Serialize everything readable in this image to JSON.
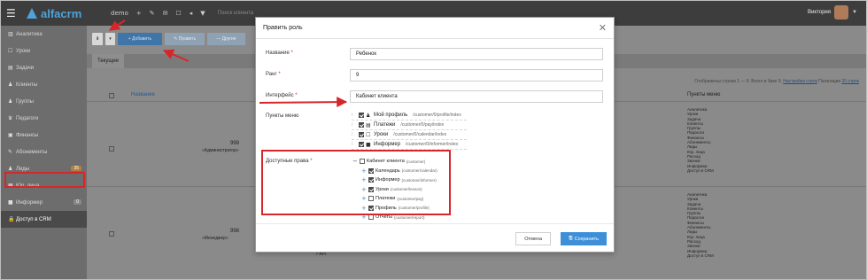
{
  "topbar": {
    "logo_text": "alfacrm",
    "menu_icon": "☰",
    "logo_mark": "logo-triangle",
    "icons": [
      "demo",
      "+",
      "✎",
      "✉",
      "☐",
      "◂",
      "▼"
    ],
    "icons_names": [
      "demo-menu-icon",
      "plus-icon",
      "pencil-icon",
      "mail-icon",
      "square-icon",
      "arrow-icon",
      "filter-icon"
    ],
    "search_placeholder": "Поиск клиента",
    "user_name": "Виктория",
    "user_caret": "▼"
  },
  "sidebar": {
    "items": [
      {
        "icon": "▥",
        "label": "Аналитика"
      },
      {
        "icon": "☐",
        "label": "Уроки"
      },
      {
        "icon": "▤",
        "label": "Задачи"
      },
      {
        "icon": "♟",
        "label": "Клиенты"
      },
      {
        "icon": "♟",
        "label": "Группы"
      },
      {
        "icon": "♛",
        "label": "Педагоги"
      },
      {
        "icon": "▣",
        "label": "Финансы"
      },
      {
        "icon": "✎",
        "label": "Абонементы"
      },
      {
        "icon": "♟",
        "label": "Лиды",
        "badge": "35"
      },
      {
        "icon": "▦",
        "label": "Юр. лица"
      },
      {
        "icon": "■",
        "label": "Информер",
        "badge": "0"
      },
      {
        "icon": "🔒",
        "label": "Доступ в CRM",
        "active": true
      }
    ]
  },
  "toolbar": {
    "sort_label": "⬇",
    "filter_label": "▾",
    "add_label": "+ Добавить",
    "edit_label": "✎ Править",
    "other_label": "— Другие"
  },
  "tabs": {
    "current": "Текущие"
  },
  "table": {
    "records_prefix": "Отображены строки 1 — 9. Всего в базе 9.",
    "settings_link": "Настройка строк",
    "pagination_label": "Пагинация",
    "pagination_value": "20 строк",
    "col_name": "Название",
    "col_menu": "Пункты меню",
    "rows": [
      {
        "num": "999",
        "sub": "«Администратор»",
        "right": ""
      },
      {
        "num": "998",
        "sub": "«Менеджер»",
        "right": "✓API"
      }
    ],
    "menu_items": [
      "Аналитика",
      "Уроки",
      "Задачи",
      "Клиенты",
      "Группы",
      "Педагоги",
      "Финансы",
      "Абонементы",
      "Лиды",
      "Юр. лица",
      "Расход",
      "Звонки",
      "Информер",
      "Доступ в CRM"
    ]
  },
  "modal": {
    "title": "Править роль",
    "close": "✕",
    "name_label": "Название",
    "name_value": "Ребенок",
    "rank_label": "Ранг",
    "rank_value": "9",
    "interface_label": "Интерфейс",
    "interface_value": "Кабинет клиента",
    "menu_label": "Пункты меню",
    "menu_points": [
      {
        "icon": "♟",
        "label": "Мой профиль",
        "path": "/customer/0/profile/index"
      },
      {
        "icon": "▤",
        "label": "Платежи",
        "path": "/customer/0/pay/index"
      },
      {
        "icon": "☐",
        "label": "Уроки",
        "path": "/customer/0/calendar/index"
      },
      {
        "icon": "■",
        "label": "Информер",
        "path": "/customer/0/informer/index"
      }
    ],
    "perm_label": "Доступные права",
    "perm_root": {
      "label": "Кабинет клиента",
      "path": "(customer)"
    },
    "perms": [
      {
        "label": "Календарь",
        "path": "(customer/calendar)",
        "checked": true
      },
      {
        "label": "Информер",
        "path": "(customer/informer)",
        "checked": true
      },
      {
        "label": "Уроки",
        "path": "(customer/lesson)",
        "checked": true
      },
      {
        "label": "Платежи",
        "path": "(customer/pay)",
        "checked": false
      },
      {
        "label": "Профиль",
        "path": "(customer/profile)",
        "checked": true
      },
      {
        "label": "Отчеты",
        "path": "(customer/report)",
        "checked": false
      }
    ],
    "cancel_label": "Отмена",
    "save_label": "Сохранить",
    "save_icon": "🖫"
  }
}
